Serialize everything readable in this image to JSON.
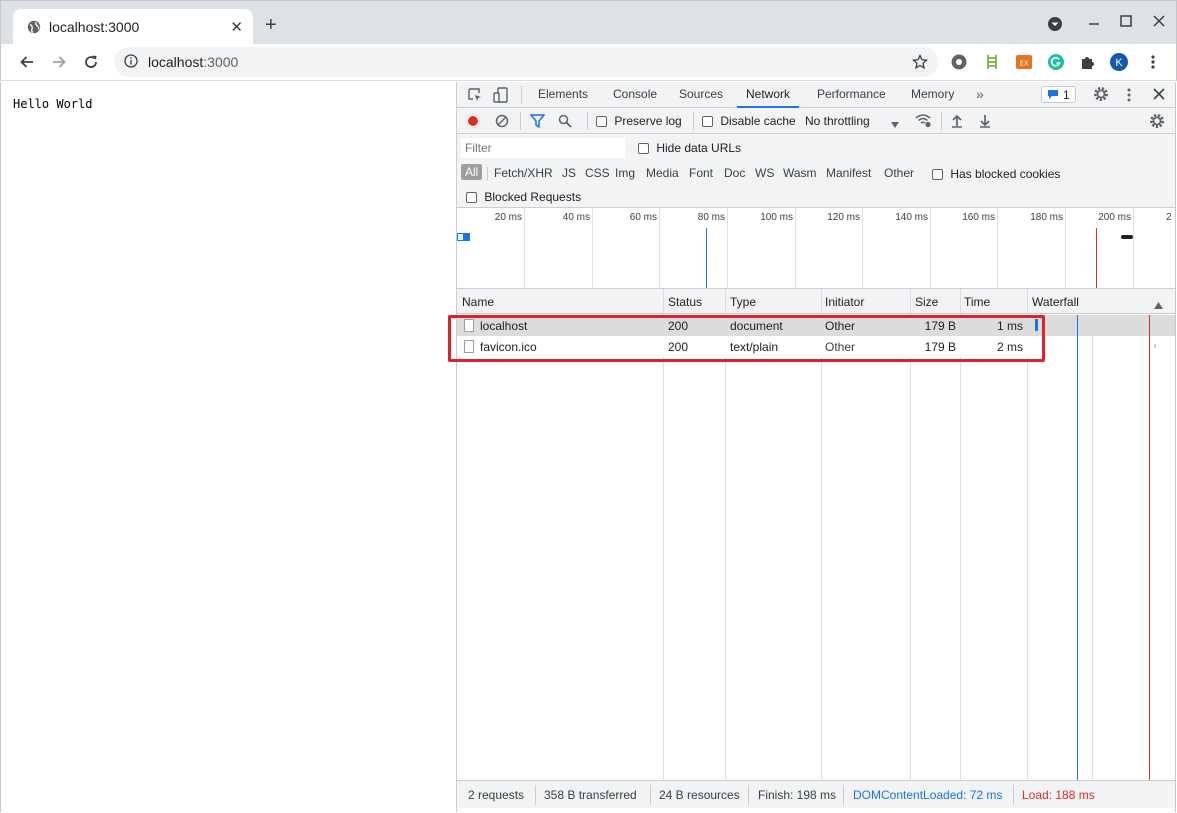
{
  "browser": {
    "tab_title": "localhost:3000",
    "new_tab": "+",
    "url_host": "localhost",
    "url_port": ":3000"
  },
  "page": {
    "text": "Hello World"
  },
  "devtools": {
    "tabs": [
      "Elements",
      "Console",
      "Sources",
      "Network",
      "Performance",
      "Memory"
    ],
    "active_tab": "Network",
    "more_tabs": "»",
    "issues_count": "1",
    "toolbar": {
      "preserve_log": "Preserve log",
      "disable_cache": "Disable cache",
      "throttling": "No throttling"
    },
    "filter": {
      "placeholder": "Filter",
      "hide_data_urls": "Hide data URLs",
      "types": [
        "All",
        "Fetch/XHR",
        "JS",
        "CSS",
        "Img",
        "Media",
        "Font",
        "Doc",
        "WS",
        "Wasm",
        "Manifest",
        "Other"
      ],
      "has_blocked_cookies": "Has blocked cookies",
      "blocked_requests": "Blocked Requests"
    },
    "overview_ticks": [
      "20 ms",
      "40 ms",
      "60 ms",
      "80 ms",
      "100 ms",
      "120 ms",
      "140 ms",
      "160 ms",
      "180 ms",
      "200 ms",
      "2"
    ],
    "columns": [
      "Name",
      "Status",
      "Type",
      "Initiator",
      "Size",
      "Time",
      "Waterfall"
    ],
    "rows": [
      {
        "name": "localhost",
        "status": "200",
        "type": "document",
        "initiator": "Other",
        "size": "179 B",
        "time": "1 ms"
      },
      {
        "name": "favicon.ico",
        "status": "200",
        "type": "text/plain",
        "initiator": "Other",
        "size": "179 B",
        "time": "2 ms"
      }
    ],
    "summary": {
      "requests": "2 requests",
      "transferred": "358 B transferred",
      "resources": "24 B resources",
      "finish": "Finish: 198 ms",
      "dom_content_loaded": "DOMContentLoaded: 72 ms",
      "load": "Load: 188 ms"
    }
  },
  "colors": {
    "accent": "#1a73e8",
    "record": "#d93025",
    "highlight": "#e0202b",
    "dcl": "#1a73e8",
    "load": "#d93025"
  }
}
